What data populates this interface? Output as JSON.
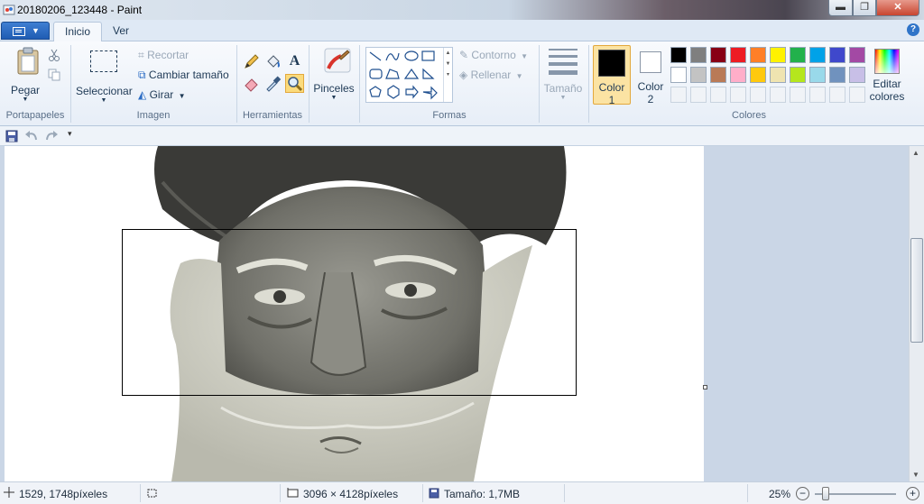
{
  "window": {
    "title": "20180206_123448 - Paint",
    "minimize": "▬",
    "maximize": "❐",
    "close": "✕"
  },
  "tabs": [
    {
      "label": "Inicio",
      "active": true
    },
    {
      "label": "Ver",
      "active": false
    }
  ],
  "help": "?",
  "ribbon": {
    "clipboard": {
      "paste_label": "Pegar",
      "group_label": "Portapapeles"
    },
    "image": {
      "select_label": "Seleccionar",
      "crop_label": "Recortar",
      "resize_label": "Cambiar tamaño",
      "rotate_label": "Girar",
      "group_label": "Imagen"
    },
    "tools": {
      "group_label": "Herramientas",
      "text_tool_glyph": "A"
    },
    "brushes": {
      "label": "Pinceles"
    },
    "shapes": {
      "outline_label": "Contorno",
      "fill_label": "Rellenar",
      "group_label": "Formas"
    },
    "size": {
      "label": "Tamaño"
    },
    "colors": {
      "color1_label": "Color",
      "color1_num": "1",
      "color2_label": "Color",
      "color2_num": "2",
      "edit_label_1": "Editar",
      "edit_label_2": "colores",
      "group_label": "Colores",
      "color1": "#000000",
      "color2": "#ffffff",
      "palette_row1": [
        "#000000",
        "#7f7f7f",
        "#880015",
        "#ed1c24",
        "#ff7f27",
        "#fff200",
        "#22b14c",
        "#00a2e8",
        "#3f48cc",
        "#a349a4"
      ],
      "palette_row2": [
        "#ffffff",
        "#c3c3c3",
        "#b97a57",
        "#ffaec9",
        "#ffc90e",
        "#efe4b0",
        "#b5e61d",
        "#99d9ea",
        "#7092be",
        "#c8bfe7"
      ]
    }
  },
  "status": {
    "cursor_pos": "1529, 1748píxeles",
    "dimensions": "3096 × 4128píxeles",
    "file_size": "Tamaño: 1,7MB",
    "zoom": "25%",
    "zoom_out": "−",
    "zoom_in": "+"
  }
}
